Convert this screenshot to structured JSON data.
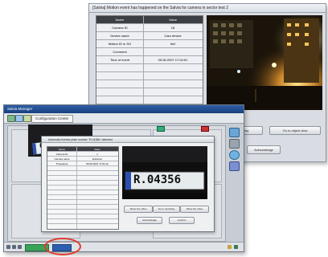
{
  "alarm_window": {
    "title": "[Salvia] Motion event has happened on the Salvia for camera in sector test 2",
    "table": {
      "headers": [
        "Name",
        "Value"
      ],
      "rows": [
        {
          "name": "Camera ID",
          "value": "18"
        },
        {
          "name": "Device name",
          "value": "Cam device"
        },
        {
          "name": "Motion ID in SO",
          "value": "3e2"
        },
        {
          "name": "Comment",
          "value": ""
        },
        {
          "name": "Time of event",
          "value": "05.06.2007 17:04:51"
        },
        {
          "name": "",
          "value": ""
        },
        {
          "name": "",
          "value": ""
        },
        {
          "name": "",
          "value": ""
        },
        {
          "name": "",
          "value": ""
        },
        {
          "name": "",
          "value": ""
        },
        {
          "name": "",
          "value": ""
        }
      ]
    },
    "buttons": {
      "left": "Go to live-display",
      "right": "Go to object view",
      "acknowledge": "Acknowledge"
    }
  },
  "manager_window": {
    "title": "Salvia Manager",
    "tab_label": "Configuration Center",
    "dialog": {
      "title": "Automatic license plate number \"R.04356\" detected",
      "table": {
        "headers": [
          "Name",
          "Value"
        ],
        "rows": [
          {
            "name": "Camera ID",
            "value": "1"
          },
          {
            "name": "Camera name",
            "value": "Entrance"
          },
          {
            "name": "Timestamp",
            "value": "05.06.2007 17:01:22"
          },
          {
            "name": "",
            "value": ""
          },
          {
            "name": "",
            "value": ""
          },
          {
            "name": "",
            "value": ""
          },
          {
            "name": "",
            "value": ""
          },
          {
            "name": "",
            "value": ""
          },
          {
            "name": "",
            "value": ""
          },
          {
            "name": "",
            "value": ""
          },
          {
            "name": "",
            "value": ""
          },
          {
            "name": "",
            "value": ""
          },
          {
            "name": "",
            "value": ""
          },
          {
            "name": "",
            "value": ""
          },
          {
            "name": "",
            "value": ""
          },
          {
            "name": "",
            "value": ""
          }
        ]
      },
      "plate_text": "R.04356",
      "buttons": {
        "b1": "Show live video",
        "b2": "Go to recording",
        "b3": "Show the video",
        "b4": "Acknowledge",
        "b5": "Confirm"
      }
    },
    "live_view_plate_fragment": "6"
  },
  "colors": {
    "alarm_highlight": "#e03a2c",
    "status_ok": "#3aa35a",
    "status_active": "#2d5fb0"
  }
}
